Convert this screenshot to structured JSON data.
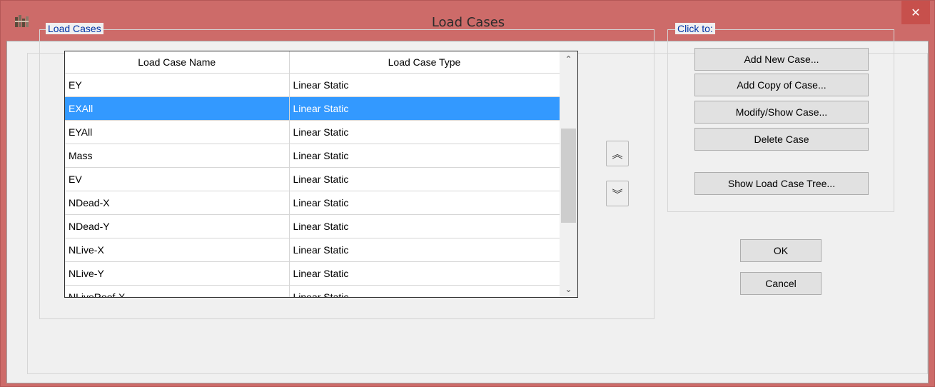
{
  "window": {
    "title": "Load Cases",
    "close_label": "✕",
    "accent_color": "#cd6b69",
    "selection_color": "#3399ff",
    "legend_color": "#0033a6"
  },
  "load_cases_group": {
    "legend": "Load Cases",
    "columns": [
      "Load Case Name",
      "Load Case Type"
    ],
    "rows": [
      {
        "name": "EY",
        "type": "Linear Static",
        "selected": false
      },
      {
        "name": "EXAll",
        "type": "Linear Static",
        "selected": true
      },
      {
        "name": "EYAll",
        "type": "Linear Static",
        "selected": false
      },
      {
        "name": "Mass",
        "type": "Linear Static",
        "selected": false
      },
      {
        "name": "EV",
        "type": "Linear Static",
        "selected": false
      },
      {
        "name": "NDead-X",
        "type": "Linear Static",
        "selected": false
      },
      {
        "name": "NDead-Y",
        "type": "Linear Static",
        "selected": false
      },
      {
        "name": "NLive-X",
        "type": "Linear Static",
        "selected": false
      },
      {
        "name": "NLive-Y",
        "type": "Linear Static",
        "selected": false
      },
      {
        "name": "NLiveRoof-X",
        "type": "Linear Static",
        "selected": false
      }
    ],
    "scroll_up_glyph": "⌃",
    "scroll_down_glyph": "⌄",
    "move_up_glyph": "︽",
    "move_down_glyph": "︾"
  },
  "click_to_group": {
    "legend": "Click to:",
    "add_new": "Add New Case...",
    "add_copy": "Add Copy of Case...",
    "modify_show": "Modify/Show Case...",
    "delete": "Delete Case",
    "show_tree": "Show Load Case Tree..."
  },
  "footer": {
    "ok": "OK",
    "cancel": "Cancel"
  }
}
